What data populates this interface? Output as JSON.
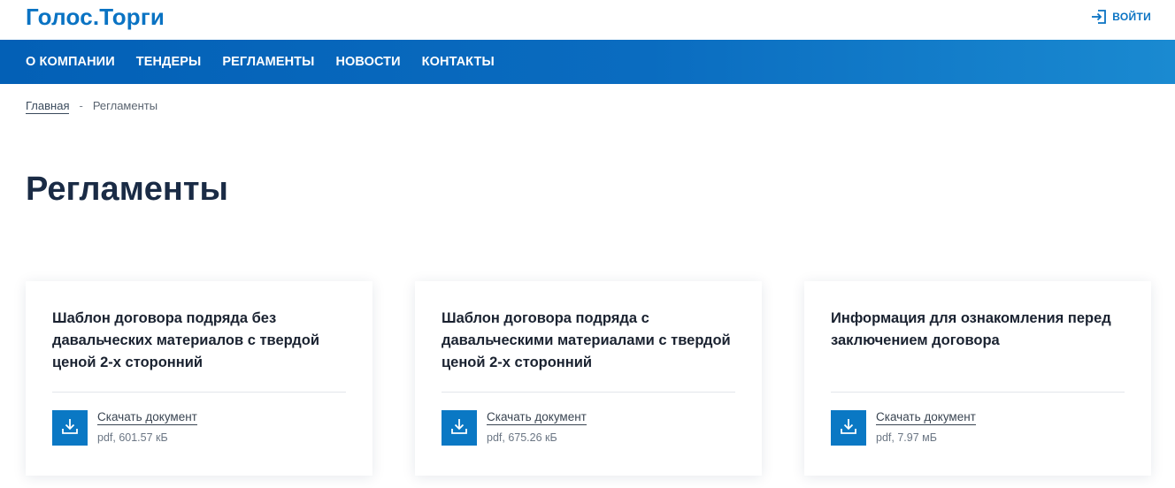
{
  "header": {
    "logo": "Голос.Торги",
    "login_label": "ВОЙТИ"
  },
  "nav": {
    "items": [
      "О КОМПАНИИ",
      "ТЕНДЕРЫ",
      "РЕГЛАМЕНТЫ",
      "НОВОСТИ",
      "КОНТАКТЫ"
    ]
  },
  "breadcrumb": {
    "home": "Главная",
    "separator": "-",
    "current": "Регламенты"
  },
  "page": {
    "title": "Регламенты"
  },
  "cards": [
    {
      "title": "Шаблон договора подряда без давальческих материалов с твердой ценой 2-х сторонний",
      "link_label": "Скачать документ",
      "meta": "pdf, 601.57 кБ"
    },
    {
      "title": "Шаблон договора подряда с давальческими материалами с твердой ценой 2-х сторонний",
      "link_label": "Скачать документ",
      "meta": "pdf, 675.26 кБ"
    },
    {
      "title": "Информация для ознакомления перед заключением договора",
      "link_label": "Скачать документ",
      "meta": "pdf, 7.97 мБ"
    }
  ],
  "colors": {
    "brand_blue": "#0a73c3",
    "nav_gradient_start": "#0360b6",
    "nav_gradient_end": "#1a8ad1",
    "download_button": "#0a78c4"
  },
  "icons": {
    "login": "login-icon",
    "download": "download-icon"
  }
}
